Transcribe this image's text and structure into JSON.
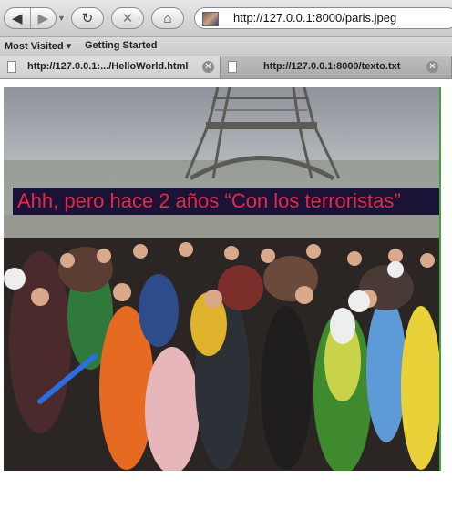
{
  "browser": {
    "url": "http://127.0.0.1:8000/paris.jpeg",
    "icons": {
      "back": "back-arrow-icon",
      "forward": "forward-arrow-icon",
      "history_dropdown": "chevron-down-icon",
      "reload": "reload-icon",
      "stop": "stop-icon",
      "home": "home-icon"
    }
  },
  "bookmarks": {
    "most_visited": "Most Visited",
    "most_visited_arrow": "▾",
    "getting_started": "Getting Started"
  },
  "tabs": [
    {
      "label": "http://127.0.0.1:.../HelloWorld.html",
      "active": true
    },
    {
      "label": "http://127.0.0.1:8000/texto.txt",
      "active": false
    }
  ],
  "content": {
    "caption": "Ahh, pero hace 2 años “Con los terroristas”",
    "colors": {
      "caption_text": "#e4294c",
      "caption_background": "#1a1336",
      "edge": "#3da33d"
    }
  }
}
